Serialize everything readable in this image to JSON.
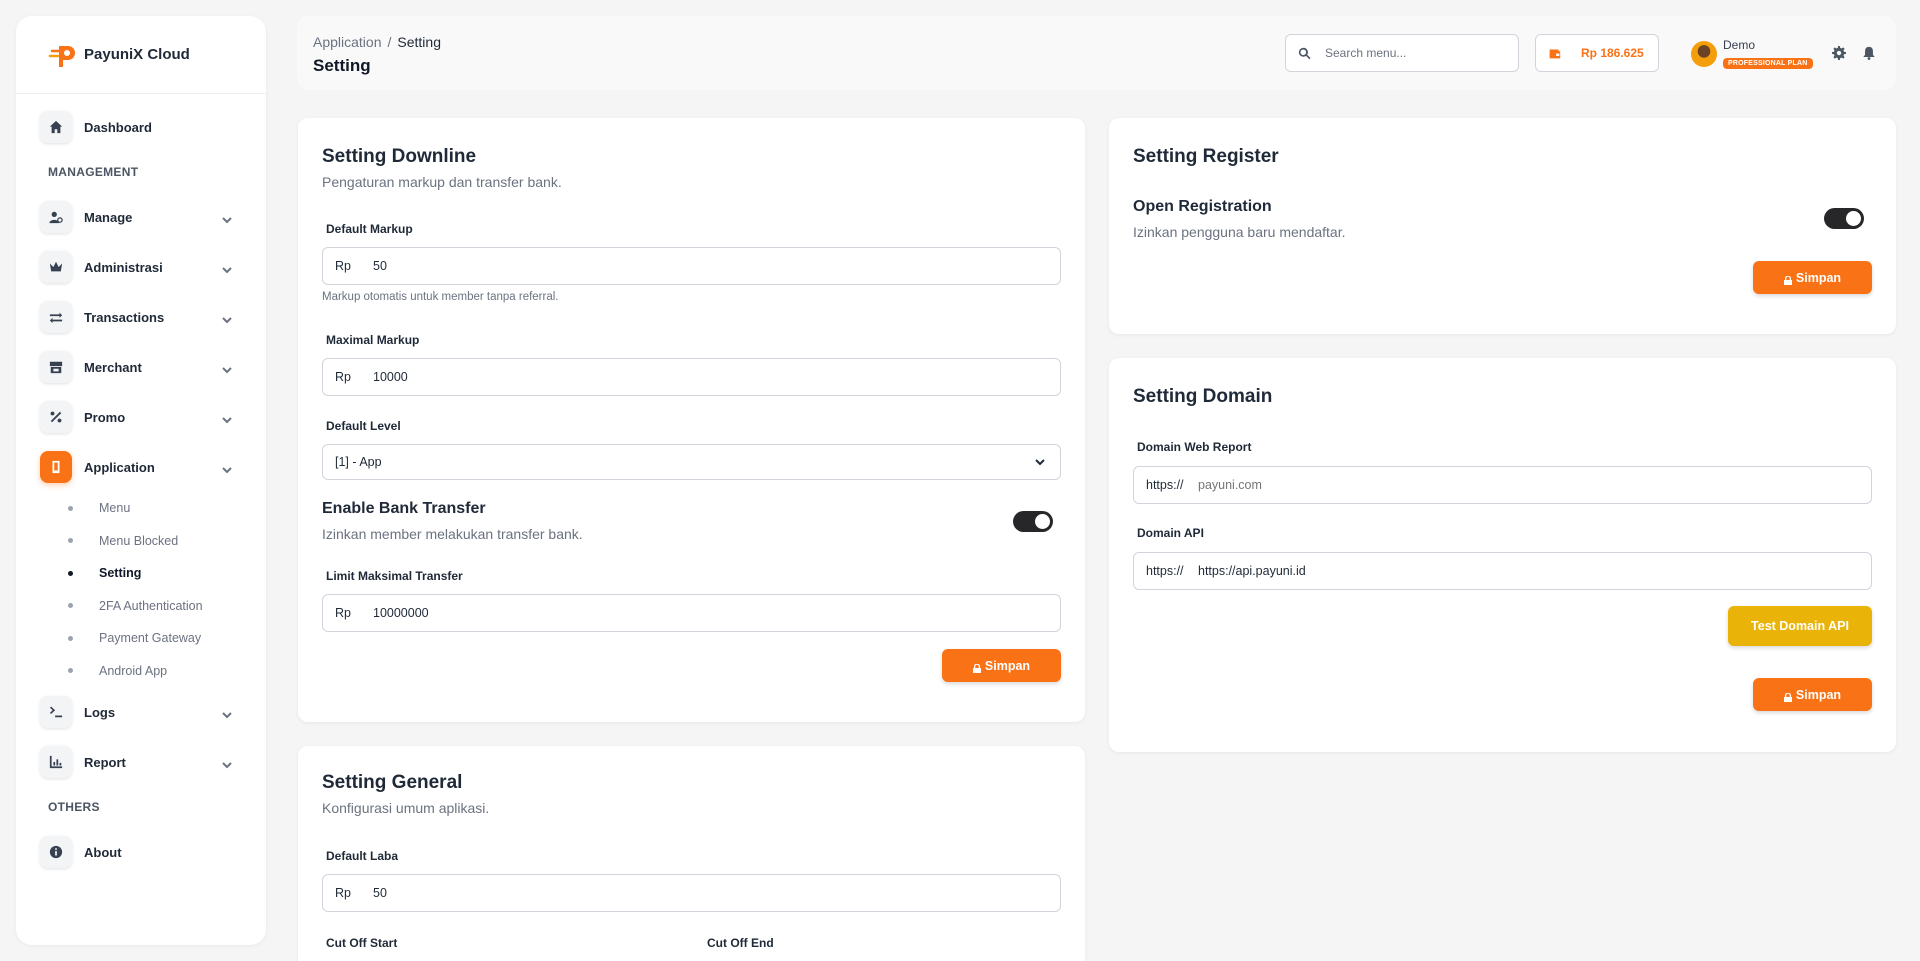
{
  "brand": {
    "name": "PayuniX Cloud"
  },
  "sidebar": {
    "dashboard": "Dashboard",
    "section_management": "MANAGEMENT",
    "items": [
      {
        "label": "Manage",
        "icon": "user-cog-icon"
      },
      {
        "label": "Administrasi",
        "icon": "crown-icon"
      },
      {
        "label": "Transactions",
        "icon": "arrows-exchange-icon"
      },
      {
        "label": "Merchant",
        "icon": "store-icon"
      },
      {
        "label": "Promo",
        "icon": "percent-icon"
      },
      {
        "label": "Application",
        "icon": "mobile-icon"
      }
    ],
    "application_sub": [
      "Menu",
      "Menu Blocked",
      "Setting",
      "2FA Authentication",
      "Payment Gateway",
      "Android App"
    ],
    "active_sub": "Setting",
    "logs": "Logs",
    "report": "Report",
    "section_others": "OTHERS",
    "about": "About"
  },
  "header": {
    "breadcrumb_parent": "Application",
    "breadcrumb_sep": "/",
    "breadcrumb_current": "Setting",
    "title": "Setting",
    "search_placeholder": "Search menu...",
    "balance": "Rp 186.625",
    "user_name": "Demo",
    "plan": "PROFESSIONAL PLAN"
  },
  "downline": {
    "title": "Setting Downline",
    "desc": "Pengaturan markup dan transfer bank.",
    "default_markup_label": "Default Markup",
    "default_markup_prefix": "Rp",
    "default_markup_value": "50",
    "default_markup_hint": "Markup otomatis untuk member tanpa referral.",
    "max_markup_label": "Maximal Markup",
    "max_markup_prefix": "Rp",
    "max_markup_value": "10000",
    "default_level_label": "Default Level",
    "default_level_value": "[1] - App",
    "bank_transfer_title": "Enable Bank Transfer",
    "bank_transfer_desc": "Izinkan member melakukan transfer bank.",
    "bank_transfer_enabled": true,
    "limit_label": "Limit Maksimal Transfer",
    "limit_prefix": "Rp",
    "limit_value": "10000000",
    "save": "Simpan"
  },
  "general": {
    "title": "Setting General",
    "desc": "Konfigurasi umum aplikasi.",
    "default_laba_label": "Default Laba",
    "default_laba_prefix": "Rp",
    "default_laba_value": "50",
    "cutoff_start_label": "Cut Off Start",
    "cutoff_end_label": "Cut Off End"
  },
  "register": {
    "title": "Setting Register",
    "open_title": "Open Registration",
    "open_desc": "Izinkan pengguna baru mendaftar.",
    "open_enabled": true,
    "save": "Simpan"
  },
  "domain": {
    "title": "Setting Domain",
    "web_label": "Domain Web Report",
    "web_prefix": "https://",
    "web_placeholder": "payuni.com",
    "api_label": "Domain API",
    "api_prefix": "https://",
    "api_value": "https://api.payuni.id",
    "test_button": "Test Domain API",
    "save": "Simpan"
  },
  "colors": {
    "accent": "#f97316",
    "warning": "#eab308",
    "toggle_on": "#27272a"
  }
}
